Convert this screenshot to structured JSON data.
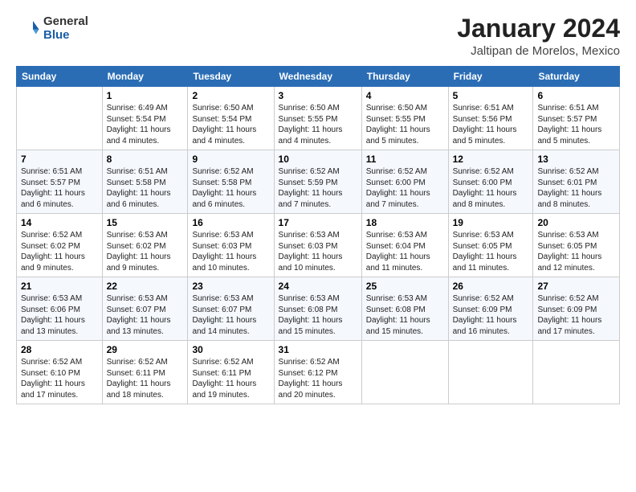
{
  "header": {
    "logo_line1": "General",
    "logo_line2": "Blue",
    "title": "January 2024",
    "subtitle": "Jaltipan de Morelos, Mexico"
  },
  "weekdays": [
    "Sunday",
    "Monday",
    "Tuesday",
    "Wednesday",
    "Thursday",
    "Friday",
    "Saturday"
  ],
  "weeks": [
    [
      {
        "day": "",
        "info": ""
      },
      {
        "day": "1",
        "info": "Sunrise: 6:49 AM\nSunset: 5:54 PM\nDaylight: 11 hours\nand 4 minutes."
      },
      {
        "day": "2",
        "info": "Sunrise: 6:50 AM\nSunset: 5:54 PM\nDaylight: 11 hours\nand 4 minutes."
      },
      {
        "day": "3",
        "info": "Sunrise: 6:50 AM\nSunset: 5:55 PM\nDaylight: 11 hours\nand 4 minutes."
      },
      {
        "day": "4",
        "info": "Sunrise: 6:50 AM\nSunset: 5:55 PM\nDaylight: 11 hours\nand 5 minutes."
      },
      {
        "day": "5",
        "info": "Sunrise: 6:51 AM\nSunset: 5:56 PM\nDaylight: 11 hours\nand 5 minutes."
      },
      {
        "day": "6",
        "info": "Sunrise: 6:51 AM\nSunset: 5:57 PM\nDaylight: 11 hours\nand 5 minutes."
      }
    ],
    [
      {
        "day": "7",
        "info": "Sunrise: 6:51 AM\nSunset: 5:57 PM\nDaylight: 11 hours\nand 6 minutes."
      },
      {
        "day": "8",
        "info": "Sunrise: 6:51 AM\nSunset: 5:58 PM\nDaylight: 11 hours\nand 6 minutes."
      },
      {
        "day": "9",
        "info": "Sunrise: 6:52 AM\nSunset: 5:58 PM\nDaylight: 11 hours\nand 6 minutes."
      },
      {
        "day": "10",
        "info": "Sunrise: 6:52 AM\nSunset: 5:59 PM\nDaylight: 11 hours\nand 7 minutes."
      },
      {
        "day": "11",
        "info": "Sunrise: 6:52 AM\nSunset: 6:00 PM\nDaylight: 11 hours\nand 7 minutes."
      },
      {
        "day": "12",
        "info": "Sunrise: 6:52 AM\nSunset: 6:00 PM\nDaylight: 11 hours\nand 8 minutes."
      },
      {
        "day": "13",
        "info": "Sunrise: 6:52 AM\nSunset: 6:01 PM\nDaylight: 11 hours\nand 8 minutes."
      }
    ],
    [
      {
        "day": "14",
        "info": "Sunrise: 6:52 AM\nSunset: 6:02 PM\nDaylight: 11 hours\nand 9 minutes."
      },
      {
        "day": "15",
        "info": "Sunrise: 6:53 AM\nSunset: 6:02 PM\nDaylight: 11 hours\nand 9 minutes."
      },
      {
        "day": "16",
        "info": "Sunrise: 6:53 AM\nSunset: 6:03 PM\nDaylight: 11 hours\nand 10 minutes."
      },
      {
        "day": "17",
        "info": "Sunrise: 6:53 AM\nSunset: 6:03 PM\nDaylight: 11 hours\nand 10 minutes."
      },
      {
        "day": "18",
        "info": "Sunrise: 6:53 AM\nSunset: 6:04 PM\nDaylight: 11 hours\nand 11 minutes."
      },
      {
        "day": "19",
        "info": "Sunrise: 6:53 AM\nSunset: 6:05 PM\nDaylight: 11 hours\nand 11 minutes."
      },
      {
        "day": "20",
        "info": "Sunrise: 6:53 AM\nSunset: 6:05 PM\nDaylight: 11 hours\nand 12 minutes."
      }
    ],
    [
      {
        "day": "21",
        "info": "Sunrise: 6:53 AM\nSunset: 6:06 PM\nDaylight: 11 hours\nand 13 minutes."
      },
      {
        "day": "22",
        "info": "Sunrise: 6:53 AM\nSunset: 6:07 PM\nDaylight: 11 hours\nand 13 minutes."
      },
      {
        "day": "23",
        "info": "Sunrise: 6:53 AM\nSunset: 6:07 PM\nDaylight: 11 hours\nand 14 minutes."
      },
      {
        "day": "24",
        "info": "Sunrise: 6:53 AM\nSunset: 6:08 PM\nDaylight: 11 hours\nand 15 minutes."
      },
      {
        "day": "25",
        "info": "Sunrise: 6:53 AM\nSunset: 6:08 PM\nDaylight: 11 hours\nand 15 minutes."
      },
      {
        "day": "26",
        "info": "Sunrise: 6:52 AM\nSunset: 6:09 PM\nDaylight: 11 hours\nand 16 minutes."
      },
      {
        "day": "27",
        "info": "Sunrise: 6:52 AM\nSunset: 6:09 PM\nDaylight: 11 hours\nand 17 minutes."
      }
    ],
    [
      {
        "day": "28",
        "info": "Sunrise: 6:52 AM\nSunset: 6:10 PM\nDaylight: 11 hours\nand 17 minutes."
      },
      {
        "day": "29",
        "info": "Sunrise: 6:52 AM\nSunset: 6:11 PM\nDaylight: 11 hours\nand 18 minutes."
      },
      {
        "day": "30",
        "info": "Sunrise: 6:52 AM\nSunset: 6:11 PM\nDaylight: 11 hours\nand 19 minutes."
      },
      {
        "day": "31",
        "info": "Sunrise: 6:52 AM\nSunset: 6:12 PM\nDaylight: 11 hours\nand 20 minutes."
      },
      {
        "day": "",
        "info": ""
      },
      {
        "day": "",
        "info": ""
      },
      {
        "day": "",
        "info": ""
      }
    ]
  ]
}
